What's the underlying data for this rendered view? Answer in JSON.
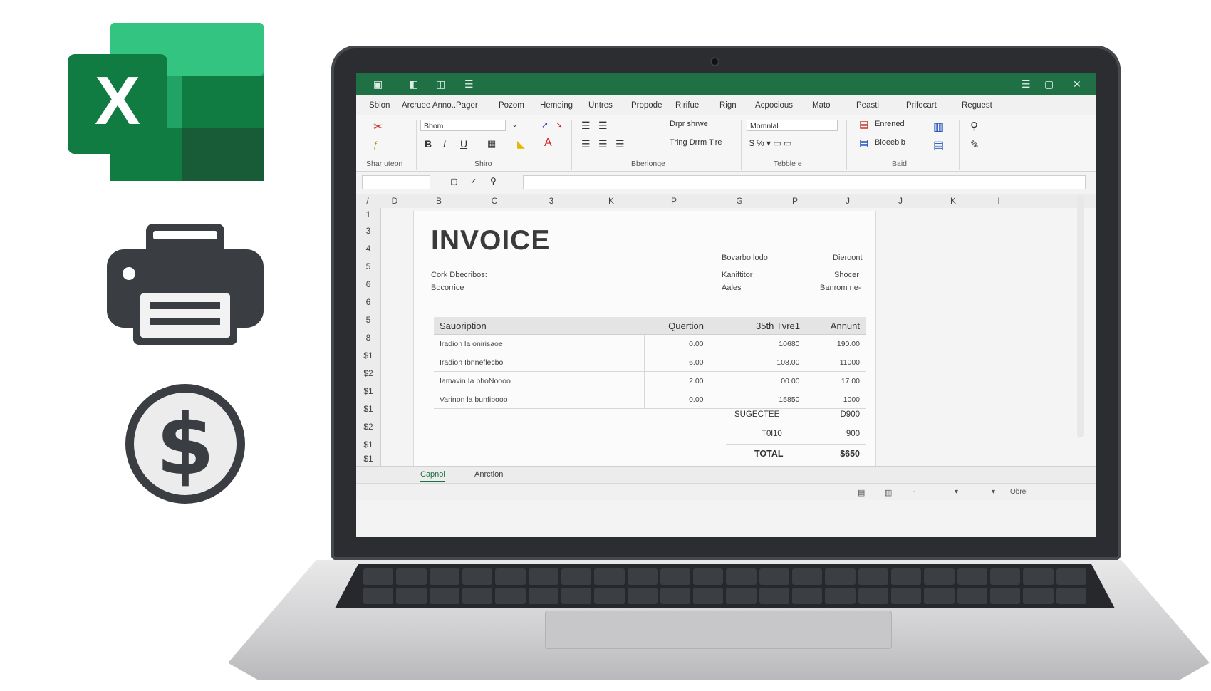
{
  "window": {
    "title_icons": [
      "save-icon",
      "undo-icon",
      "redo-icon",
      "menu-icon"
    ],
    "controls": [
      "ribbon-display-icon",
      "restore-icon",
      "close-icon"
    ],
    "close_glyph": "✕",
    "brand_color": "#1f7145"
  },
  "menu": [
    "Sblon",
    "Arcruee Anno..",
    "Pager",
    "Pozom",
    "Hemeing",
    "Untres",
    "Propode",
    "Rlrifue",
    "Rign",
    "Acpocious",
    "Mato",
    "Peasti",
    "Prifecart",
    "Reguest"
  ],
  "ribbon": {
    "font_name": "Bbom",
    "font_style": "Momnlal",
    "wrap_label": "Drpr shrwe",
    "merge_label": "Tring  Drrm Tire",
    "styles_1": "Enrened",
    "styles_2": "Bioeeblb",
    "groups": [
      "Shar uteon",
      "Shiro",
      "Bberlonge",
      "Tebble e",
      "Baid"
    ],
    "bold": "B",
    "italic": "I",
    "underline": "U",
    "font_color_glyph": "A"
  },
  "columns": [
    "D",
    "B",
    "C",
    "3",
    "K",
    "P",
    "G",
    "P",
    "J",
    "J",
    "K",
    "I"
  ],
  "rows": [
    "f",
    "1",
    "3",
    "4",
    "5",
    "6",
    "6",
    "5",
    "8",
    "$1",
    "$2",
    "$1",
    "$1",
    "$2",
    "$1",
    "$1"
  ],
  "invoice": {
    "title": "INVOICE",
    "left_meta": [
      "Cork Dbecribos:",
      "Bocorrice"
    ],
    "right_meta_labels": [
      "Bovarbo lodo",
      "Kaniftitor",
      "Aales"
    ],
    "right_meta_values": [
      "Dieroont",
      "Shocer",
      "Banrom ne-"
    ],
    "table_headers": [
      "Sauoription",
      "Quertion",
      "35th Tvre1",
      "Annunt"
    ],
    "rows": [
      {
        "desc": "Iradion la onirisaoe",
        "qty": "0.00",
        "price": "10680",
        "amount": "190.00"
      },
      {
        "desc": "Iradion Ibnneflecbo",
        "qty": "6.00",
        "price": "108.00",
        "amount": "11000"
      },
      {
        "desc": "Iamavin Ia bhoNoooo",
        "qty": "2.00",
        "price": "00.00",
        "amount": "17.00"
      },
      {
        "desc": "Varinon la bunfibooo",
        "qty": "0.00",
        "price": "15850",
        "amount": "1000"
      }
    ],
    "subtotal_label": "SUGECTEE",
    "subtotal_value": "D900",
    "tax_label": "T0l10",
    "tax_value": "900",
    "total_label": "TOTAL",
    "total_value": "$650"
  },
  "sheet_tabs": [
    "Capnol",
    "Anrction"
  ],
  "status": {
    "zoom_label": "Obrei"
  }
}
